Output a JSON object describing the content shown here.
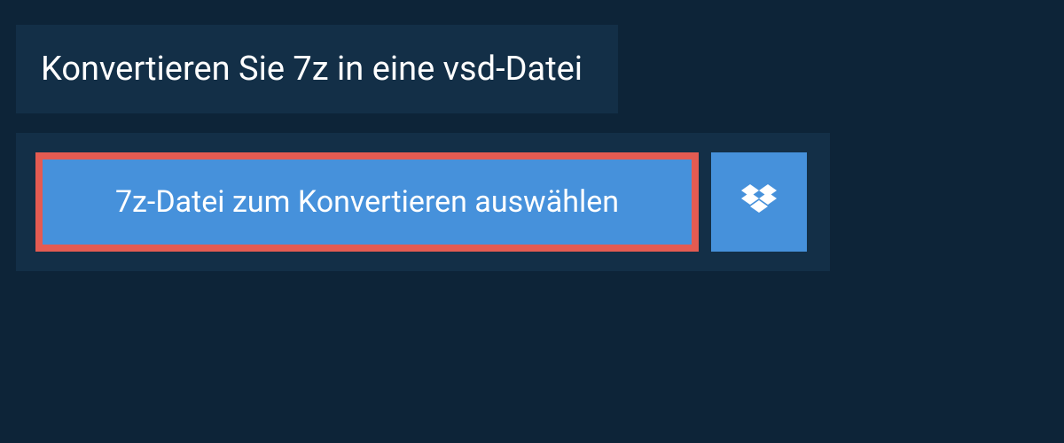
{
  "header": {
    "title": "Konvertieren Sie 7z in eine vsd-Datei"
  },
  "actions": {
    "select_file_label": "7z-Datei zum Konvertieren auswählen",
    "dropbox_icon_name": "dropbox"
  },
  "colors": {
    "page_bg": "#0d2438",
    "panel_bg": "#132f47",
    "button_bg": "#4691db",
    "highlight_border": "#e45b52",
    "text": "#ffffff"
  }
}
